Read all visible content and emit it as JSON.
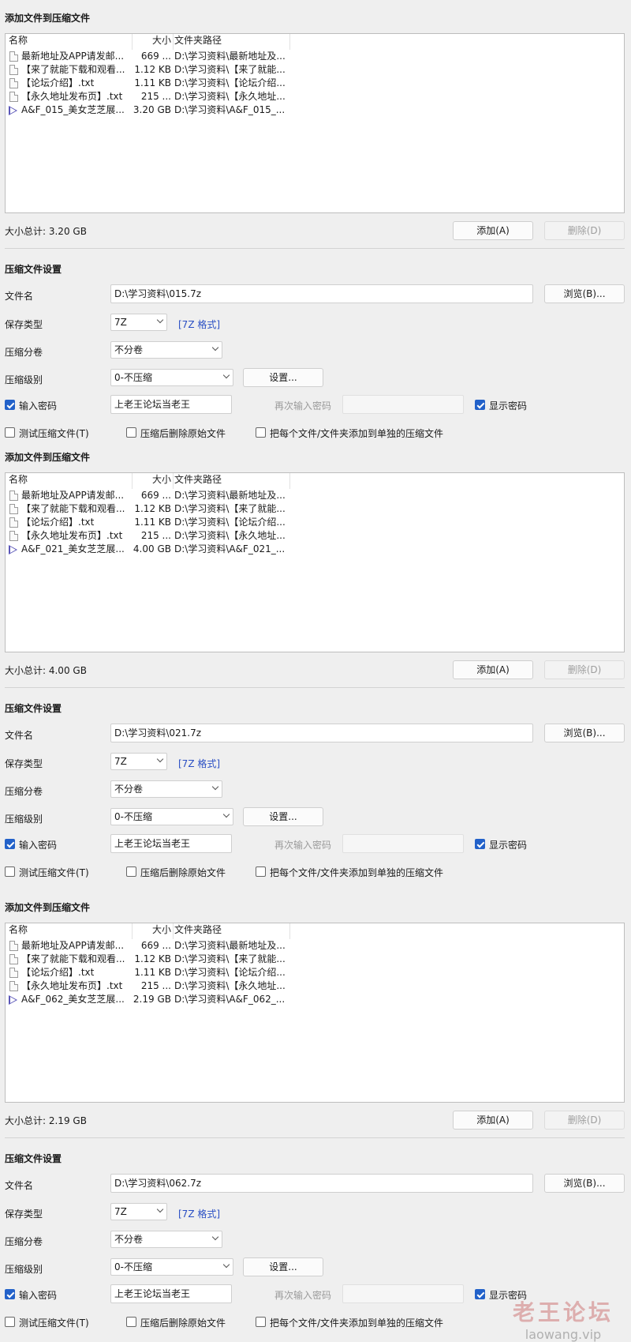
{
  "labels": {
    "add_section": "添加文件到压缩文件",
    "settings_section": "压缩文件设置",
    "col_name": "名称",
    "col_size": "大小",
    "col_path": "文件夹路径",
    "add_btn": "添加(A)",
    "delete_btn": "删除(D)",
    "filename": "文件名",
    "browse_btn": "浏览(B)...",
    "save_type": "保存类型",
    "split": "压缩分卷",
    "level": "压缩级别",
    "settings_btn": "设置...",
    "password": "输入密码",
    "reenter_password": "再次输入密码",
    "show_password": "显示密码",
    "test_archive": "测试压缩文件(T)",
    "delete_after": "压缩后删除原始文件",
    "each_separately": "把每个文件/文件夹添加到单独的压缩文件"
  },
  "panels": [
    {
      "files": [
        {
          "name": "最新地址及APP请发邮...",
          "size": "669 ...",
          "path": "D:\\学习资料\\最新地址及...",
          "icon": "doc"
        },
        {
          "name": "【来了就能下载和观看...",
          "size": "1.12 KB",
          "path": "D:\\学习资料\\【来了就能...",
          "icon": "doc"
        },
        {
          "name": "【论坛介绍】.txt",
          "size": "1.11 KB",
          "path": "D:\\学习资料\\【论坛介绍...",
          "icon": "doc"
        },
        {
          "name": "【永久地址发布页】.txt",
          "size": "215 ...",
          "path": "D:\\学习资料\\【永久地址...",
          "icon": "doc"
        },
        {
          "name": "A&F_015_美女芝芝展...",
          "size": "3.20 GB",
          "path": "D:\\学习资料\\A&F_015_...",
          "icon": "video"
        }
      ],
      "total": "大小总计: 3.20 GB",
      "filename": "D:\\学习资料\\015.7z",
      "save_type": "7Z",
      "format_link": "[7Z 格式]",
      "split": "不分卷",
      "level": "0-不压缩",
      "password": "上老王论坛当老王",
      "password_checked": true,
      "show_password_checked": true,
      "test_checked": false,
      "delete_checked": false,
      "each_checked": false
    },
    {
      "files": [
        {
          "name": "最新地址及APP请发邮...",
          "size": "669 ...",
          "path": "D:\\学习资料\\最新地址及...",
          "icon": "doc"
        },
        {
          "name": "【来了就能下载和观看...",
          "size": "1.12 KB",
          "path": "D:\\学习资料\\【来了就能...",
          "icon": "doc"
        },
        {
          "name": "【论坛介绍】.txt",
          "size": "1.11 KB",
          "path": "D:\\学习资料\\【论坛介绍...",
          "icon": "doc"
        },
        {
          "name": "【永久地址发布页】.txt",
          "size": "215 ...",
          "path": "D:\\学习资料\\【永久地址...",
          "icon": "doc"
        },
        {
          "name": "A&F_021_美女芝芝展...",
          "size": "4.00 GB",
          "path": "D:\\学习资料\\A&F_021_...",
          "icon": "video"
        }
      ],
      "total": "大小总计: 4.00 GB",
      "filename": "D:\\学习资料\\021.7z",
      "save_type": "7Z",
      "format_link": "[7Z 格式]",
      "split": "不分卷",
      "level": "0-不压缩",
      "password": "上老王论坛当老王",
      "password_checked": true,
      "show_password_checked": true,
      "test_checked": false,
      "delete_checked": false,
      "each_checked": false
    },
    {
      "files": [
        {
          "name": "最新地址及APP请发邮...",
          "size": "669 ...",
          "path": "D:\\学习资料\\最新地址及...",
          "icon": "doc"
        },
        {
          "name": "【来了就能下载和观看...",
          "size": "1.12 KB",
          "path": "D:\\学习资料\\【来了就能...",
          "icon": "doc"
        },
        {
          "name": "【论坛介绍】.txt",
          "size": "1.11 KB",
          "path": "D:\\学习资料\\【论坛介绍...",
          "icon": "doc"
        },
        {
          "name": "【永久地址发布页】.txt",
          "size": "215 ...",
          "path": "D:\\学习资料\\【永久地址...",
          "icon": "doc"
        },
        {
          "name": "A&F_062_美女芝芝展...",
          "size": "2.19 GB",
          "path": "D:\\学习资料\\A&F_062_...",
          "icon": "video"
        }
      ],
      "total": "大小总计: 2.19 GB",
      "filename": "D:\\学习资料\\062.7z",
      "save_type": "7Z",
      "format_link": "[7Z 格式]",
      "split": "不分卷",
      "level": "0-不压缩",
      "password": "上老王论坛当老王",
      "password_checked": true,
      "show_password_checked": true,
      "test_checked": false,
      "delete_checked": false,
      "each_checked": false
    }
  ],
  "watermark": {
    "main": "老王论坛",
    "sub": "laowang.vip"
  },
  "colors": {
    "accent": "#2261c9",
    "link": "#2a4fc4",
    "background": "#efefef"
  }
}
